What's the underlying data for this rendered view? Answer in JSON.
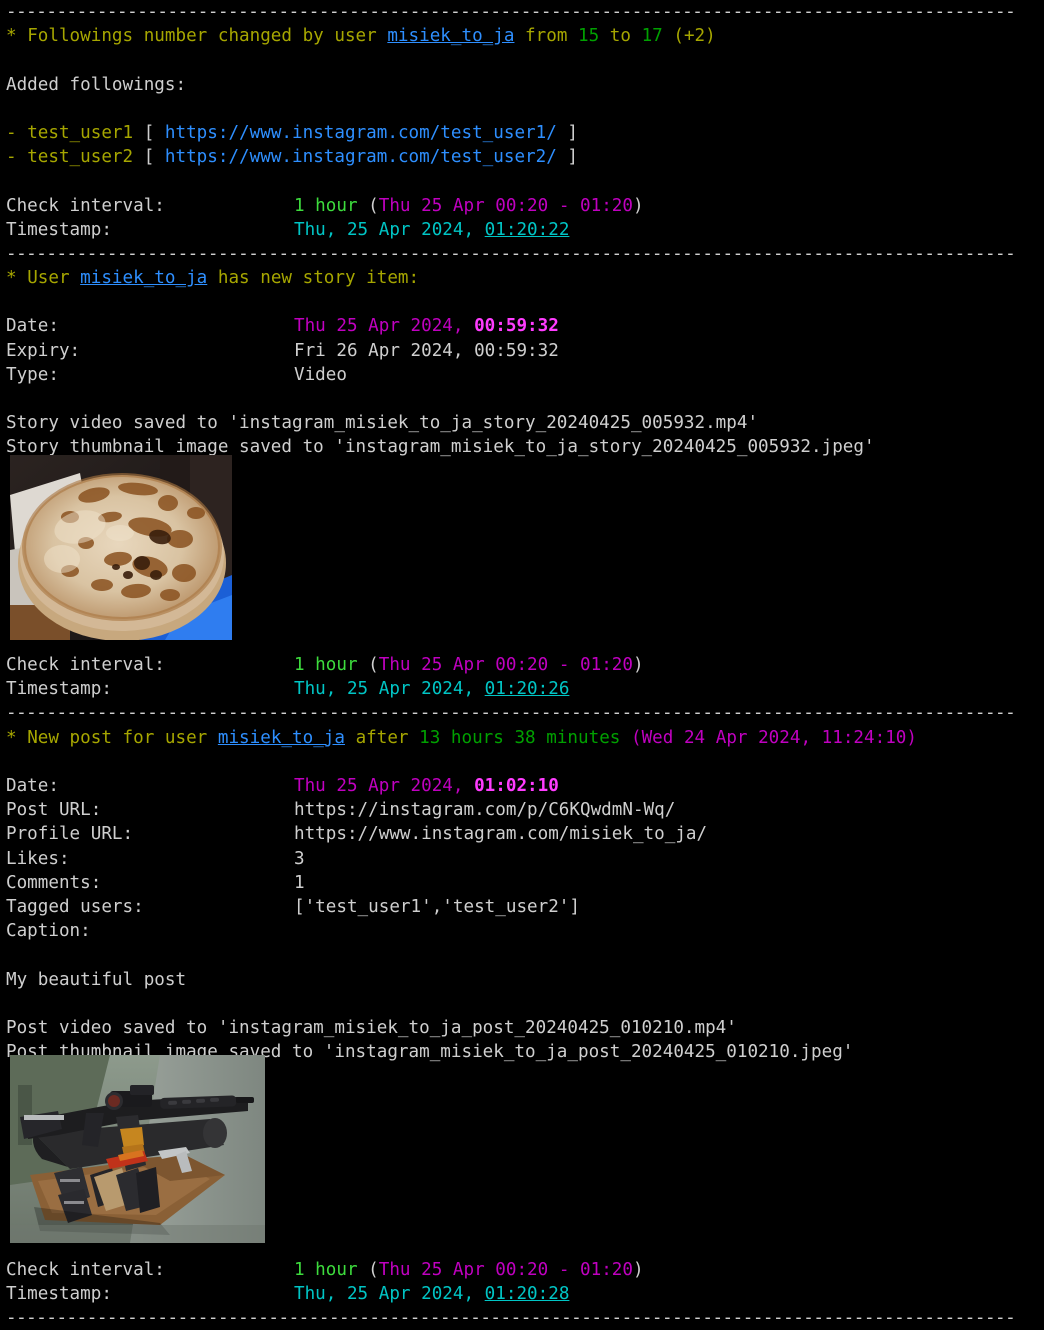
{
  "terminal": {
    "title": "instagram-monitor terminal output",
    "separator": "----------------------------------------------------------------------------------------------------",
    "colors": {
      "background": "#000000",
      "default_text": "#cfcfcf",
      "olive": "#a6a600",
      "green": "#00a000",
      "bright_green": "#3ddc3d",
      "blue": "#2e8fff",
      "magenta": "#c000c0",
      "bright_magenta": "#ff3cff",
      "cyan": "#00c5c5"
    }
  },
  "block_followings": {
    "header": {
      "marker": "*",
      "text_1": "Followings number changed by user",
      "username": "misiek_to_ja",
      "text_2": "from",
      "old_count": "15",
      "text_3": "to",
      "new_count": "17",
      "delta": "(+2)"
    },
    "added_label": "Added followings:",
    "added": [
      {
        "bullet": "-",
        "user": "test_user1",
        "open_bracket": "[",
        "url": "https://www.instagram.com/test_user1/",
        "close_bracket": "]"
      },
      {
        "bullet": "-",
        "user": "test_user2",
        "open_bracket": "[",
        "url": "https://www.instagram.com/test_user2/",
        "close_bracket": "]"
      }
    ],
    "check_interval_label": "Check interval:",
    "check_interval_value": "1 hour",
    "check_interval_range": "Thu 25 Apr 00:20 - 01:20",
    "timestamp_label": "Timestamp:",
    "timestamp_date": "Thu, 25 Apr 2024,",
    "timestamp_time": "01:20:22"
  },
  "block_story": {
    "header": {
      "marker": "*",
      "text_1": "User",
      "username": "misiek_to_ja",
      "text_2": "has new story item:"
    },
    "fields": {
      "date_label": "Date:",
      "date_value": "Thu 25 Apr 2024,",
      "date_time": "00:59:32",
      "expiry_label": "Expiry:",
      "expiry_value": "Fri 26 Apr 2024, 00:59:32",
      "type_label": "Type:",
      "type_value": "Video"
    },
    "video_saved": "Story video saved to 'instagram_misiek_to_ja_story_20240425_005932.mp4'",
    "thumbnail_saved": "Story thumbnail image saved to 'instagram_misiek_to_ja_story_20240425_005932.jpeg'",
    "thumbnail_alt": "story-thumbnail-pancakes",
    "check_interval_label": "Check interval:",
    "check_interval_value": "1 hour",
    "check_interval_range": "Thu 25 Apr 00:20 - 01:20",
    "timestamp_label": "Timestamp:",
    "timestamp_date": "Thu, 25 Apr 2024,",
    "timestamp_time": "01:20:26"
  },
  "block_post": {
    "header": {
      "marker": "*",
      "text_1": "New post for user",
      "username": "misiek_to_ja",
      "text_2": "after",
      "elapsed": "13 hours 38 minutes",
      "prev_date": "(Wed 24 Apr 2024, 11:24:10)"
    },
    "fields": {
      "date_label": "Date:",
      "date_value": "Thu 25 Apr 2024,",
      "date_time": "01:02:10",
      "post_url_label": "Post URL:",
      "post_url_value": "https://instagram.com/p/C6KQwdmN-Wq/",
      "profile_url_label": "Profile URL:",
      "profile_url_value": "https://www.instagram.com/misiek_to_ja/",
      "likes_label": "Likes:",
      "likes_value": "3",
      "comments_label": "Comments:",
      "comments_value": "1",
      "tagged_label": "Tagged users:",
      "tagged_value": "['test_user1','test_user2']",
      "caption_label": "Caption:"
    },
    "caption_text": "My beautiful post",
    "video_saved": "Post video saved to 'instagram_misiek_to_ja_post_20240425_010210.mp4'",
    "thumbnail_saved": "Post thumbnail image saved to 'instagram_misiek_to_ja_post_20240425_010210.jpeg'",
    "thumbnail_alt": "post-thumbnail-rifle-on-table",
    "check_interval_label": "Check interval:",
    "check_interval_value": "1 hour",
    "check_interval_range": "Thu 25 Apr 00:20 - 01:20",
    "timestamp_label": "Timestamp:",
    "timestamp_date": "Thu, 25 Apr 2024,",
    "timestamp_time": "01:20:28"
  }
}
